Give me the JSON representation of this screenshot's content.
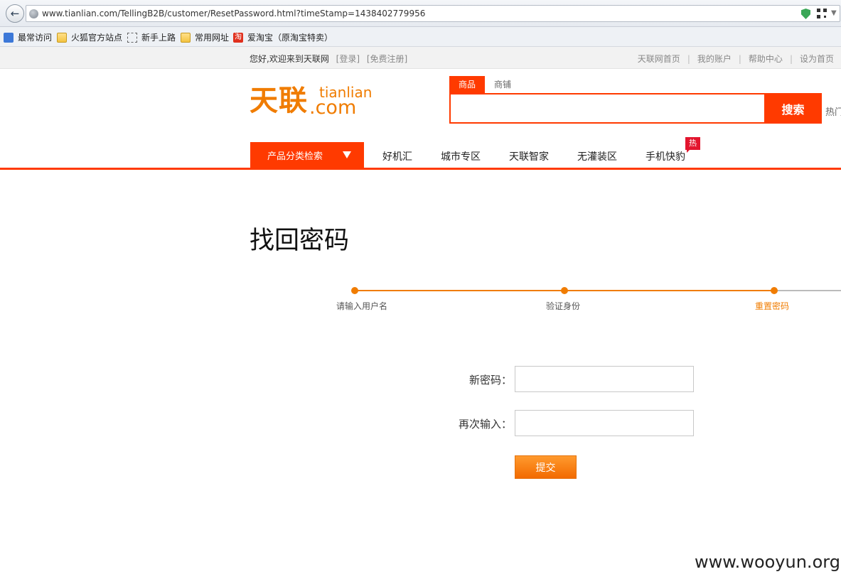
{
  "browser": {
    "url": "www.tianlian.com/TellingB2B/customer/ResetPassword.html?timeStamp=1438402779956",
    "bookmarks": [
      "最常访问",
      "火狐官方站点",
      "新手上路",
      "常用网址",
      "爱淘宝（原淘宝特卖）"
    ]
  },
  "topbar": {
    "welcome": "您好,欢迎来到天联网",
    "login": "[登录]",
    "register": "[免费注册]",
    "links": [
      "天联网首页",
      "我的账户",
      "帮助中心",
      "设为首页"
    ]
  },
  "logo": {
    "cn": "天联",
    "en_top": "tianlian",
    "en_bottom": ".com"
  },
  "search": {
    "tabs": [
      "商品",
      "商铺"
    ],
    "active_tab": "商品",
    "value": "",
    "button": "搜索",
    "hot_label": "热门"
  },
  "nav": {
    "category_button": "产品分类检索",
    "items": [
      "好机汇",
      "城市专区",
      "天联智家",
      "无灌装区",
      "手机快豹"
    ],
    "hot_badge": "热"
  },
  "main": {
    "title": "找回密码",
    "steps": [
      {
        "label": "请输入用户名",
        "state": "done"
      },
      {
        "label": "验证身份",
        "state": "done"
      },
      {
        "label": "重置密码",
        "state": "current"
      }
    ],
    "form": {
      "new_password_label": "新密码：",
      "confirm_label": "再次输入：",
      "new_password_value": "",
      "confirm_value": "",
      "submit": "提交"
    }
  },
  "watermark": "www.wooyun.org",
  "colors": {
    "accent": "#ff3a00",
    "orange": "#f07c00",
    "badge": "#e3152e"
  }
}
